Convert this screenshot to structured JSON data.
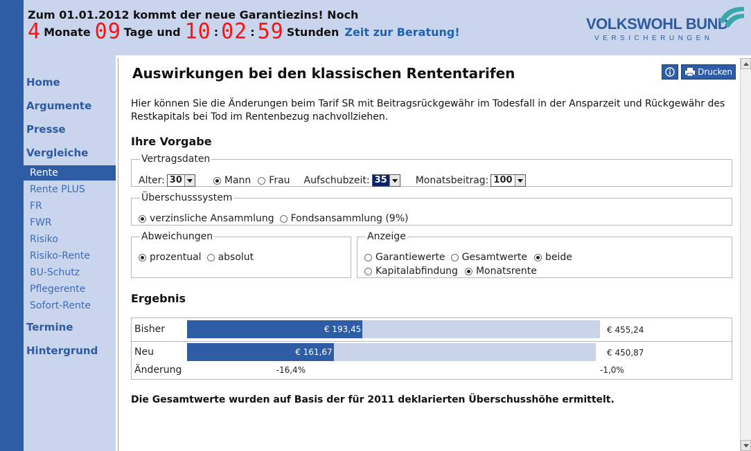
{
  "header": {
    "line1": "Zum 01.01.2012 kommt der neue Garantiezins! Noch",
    "countdown": {
      "months": "4",
      "months_label": "Monate",
      "days": "09",
      "days_label": "Tage und",
      "hours": "10",
      "minutes": "02",
      "seconds": "59",
      "sep": ":",
      "hours_label": "Stunden"
    },
    "link": "Zeit zur Beratung!",
    "logo_word": "VOLKSWOHL BUND",
    "logo_sub": "VERSICHERUNGEN"
  },
  "sidebar": {
    "main_items": [
      "Home",
      "Argumente",
      "Presse",
      "Vergleiche",
      "Termine",
      "Hintergrund"
    ],
    "sub_items": [
      "Rente",
      "Rente PLUS",
      "FR",
      "FWR",
      "Risiko",
      "Risiko-Rente",
      "BU-Schutz",
      "Pflegerente",
      "Sofort-Rente"
    ],
    "active_sub": "Rente"
  },
  "content": {
    "title": "Auswirkungen bei den klassischen Rententarifen",
    "print_label": "Drucken",
    "intro": "Hier können Sie die Änderungen beim Tarif SR mit Beitragsrückgewähr im Todesfall in der Ansparzeit und Rückgewähr des Restkapitals bei Tod im Rentenbezug nachvollziehen.",
    "vorgabe_heading": "Ihre Vorgabe",
    "vertragsdaten": {
      "legend": "Vertragsdaten",
      "alter_label": "Alter:",
      "alter_value": "30",
      "mann": "Mann",
      "frau": "Frau",
      "gender_selected": "Mann",
      "aufschub_label": "Aufschubzeit:",
      "aufschub_value": "35",
      "beitrag_label": "Monatsbeitrag:",
      "beitrag_value": "100"
    },
    "ueberschuss": {
      "legend": "Überschusssystem",
      "opt1": "verzinsliche Ansammlung",
      "opt2": "Fondsansammlung (9%)",
      "selected": "opt1"
    },
    "abweichungen": {
      "legend": "Abweichungen",
      "opt1": "prozentual",
      "opt2": "absolut",
      "selected": "opt1"
    },
    "anzeige": {
      "legend": "Anzeige",
      "opt1": "Garantiewerte",
      "opt2": "Gesamtwerte",
      "opt3": "beide",
      "opt4": "Kapitalabfindung",
      "opt5": "Monatsrente",
      "selected_row1": "opt3",
      "selected_row2": "opt5"
    },
    "ergebnis_heading": "Ergebnis",
    "result": {
      "rows": [
        {
          "label": "Bisher",
          "guarantee": "€ 193,45",
          "guarantee_value": 193.45,
          "total": "€ 455,24",
          "total_value": 455.24
        },
        {
          "label": "Neu",
          "guarantee": "€ 161,67",
          "guarantee_value": 161.67,
          "total": "€ 450,87",
          "total_value": 450.87
        }
      ],
      "change_label": "Änderung",
      "change_guarantee": "-16,4%",
      "change_total": "-1,0%"
    },
    "footnote": "Die Gesamtwerte wurden auf Basis der für 2011 deklarierten Überschusshöhe ermittelt."
  },
  "colors": {
    "brand_blue": "#2f5da5",
    "nav_bg": "#c9d5ec",
    "bar_light": "#c9d3ea",
    "countdown_red": "#ff1010",
    "link_blue": "#1e62b4"
  }
}
